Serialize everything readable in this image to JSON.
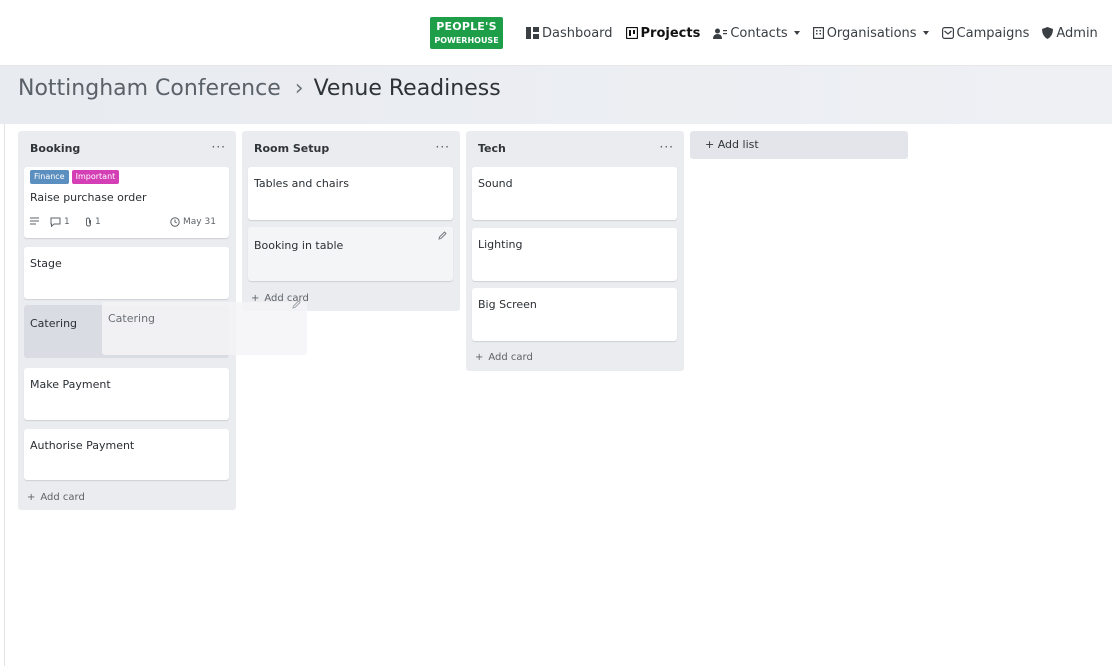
{
  "nav": {
    "logo_line1": "PEOPLE'S",
    "logo_line2": "POWERHOUSE",
    "logo_color": "#1f9e4a",
    "items": [
      {
        "label": "Dashboard",
        "icon": "dashboard-icon"
      },
      {
        "label": "Projects",
        "icon": "projects-icon",
        "active": true
      },
      {
        "label": "Contacts",
        "icon": "contacts-icon",
        "dropdown": true
      },
      {
        "label": "Organisations",
        "icon": "building-icon",
        "dropdown": true
      },
      {
        "label": "Campaigns",
        "icon": "campaigns-icon"
      },
      {
        "label": "Admin",
        "icon": "shield-icon"
      }
    ]
  },
  "breadcrumb": {
    "parent": "Nottingham Conference",
    "separator": "›",
    "current": "Venue Readiness"
  },
  "lists": [
    {
      "title": "Booking",
      "menu": "···",
      "cards": [
        {
          "title": "Raise purchase order",
          "labels": [
            {
              "text": "Finance",
              "color": "#5b8fbf"
            },
            {
              "text": "Important",
              "color": "#d43fb5"
            }
          ],
          "comments": "1",
          "attachments": "1",
          "due": "May 31"
        },
        {
          "title": "Stage"
        },
        {
          "title": "Catering"
        },
        {
          "title": "Make Payment"
        },
        {
          "title": "Authorise Payment"
        }
      ],
      "add_card": "Add card"
    },
    {
      "title": "Room Setup",
      "menu": "···",
      "cards": [
        {
          "title": "Tables and chairs"
        },
        {
          "title": "Booking in table"
        }
      ],
      "add_card": "Add card"
    },
    {
      "title": "Tech",
      "menu": "···",
      "cards": [
        {
          "title": "Sound"
        },
        {
          "title": "Lighting"
        },
        {
          "title": "Big Screen"
        }
      ],
      "add_card": "Add card"
    }
  ],
  "dragging_card": {
    "title": "Catering"
  },
  "add_list": "Add list"
}
